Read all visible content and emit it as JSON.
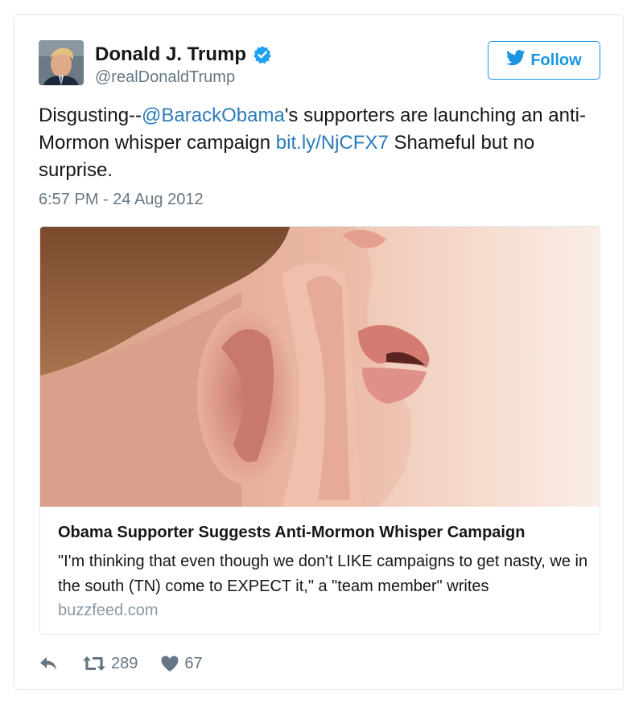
{
  "user": {
    "display_name": "Donald J. Trump",
    "handle": "@realDonaldTrump",
    "verified_icon": "verified-badge-icon"
  },
  "follow_button": {
    "label": "Follow",
    "icon": "twitter-bird-icon"
  },
  "tweet": {
    "text_before_mention": "Disgusting--",
    "mention": "@BarackObama",
    "text_after_mention": "'s supporters are launching an anti-Mormon whisper campaign ",
    "link": "bit.ly/NjCFX7",
    "text_after_link": " Shameful but no surprise.",
    "timestamp": "6:57 PM - 24 Aug 2012"
  },
  "card": {
    "title": "Obama Supporter Suggests Anti-Mormon Whisper Campaign",
    "description": "\"I'm thinking that even though we don't LIKE campaigns to get nasty, we in the south (TN) come to EXPECT it,\" a \"team member\" writes",
    "domain": "buzzfeed.com"
  },
  "actions": {
    "reply_icon": "reply-icon",
    "retweet_icon": "retweet-icon",
    "retweet_count": "289",
    "like_icon": "heart-icon",
    "like_count": "67"
  },
  "colors": {
    "link_blue": "#2b7bb9",
    "follow_blue": "#1b95e0",
    "muted_gray": "#657786",
    "border": "#e1e8ed"
  }
}
